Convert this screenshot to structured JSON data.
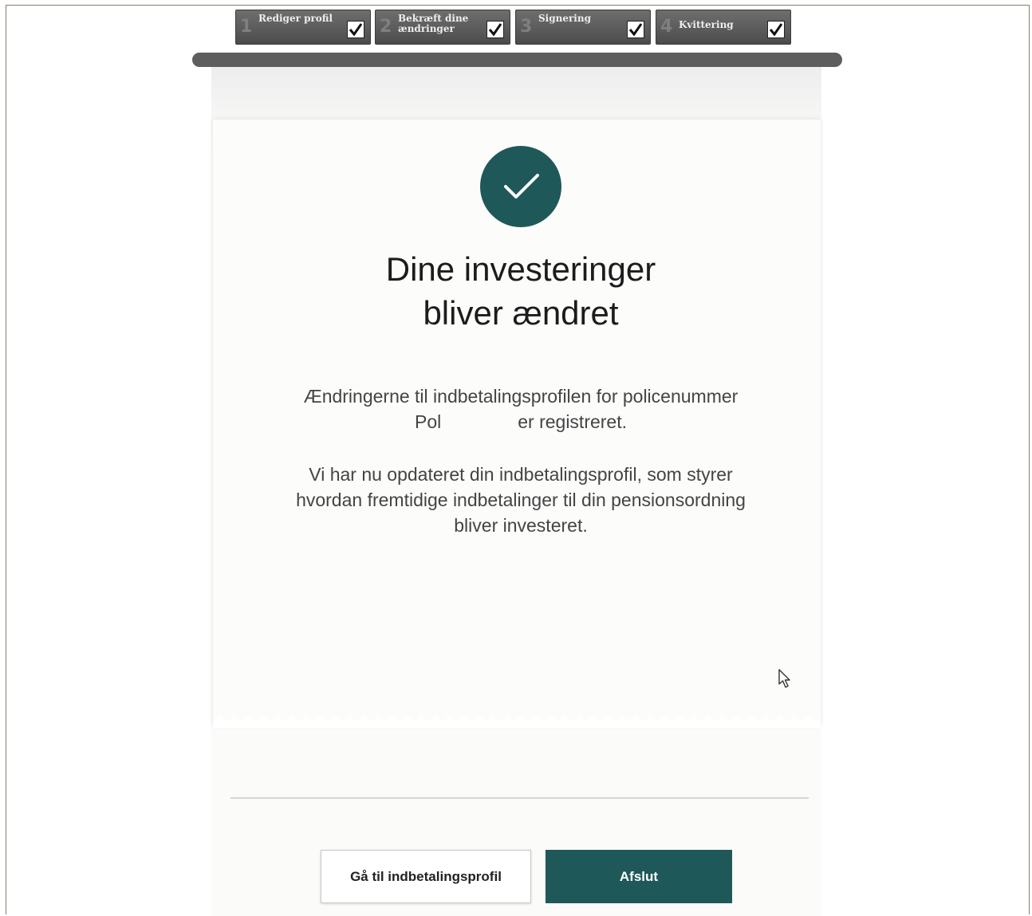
{
  "stepper": {
    "steps": [
      {
        "number": "1",
        "label": "Rediger profil",
        "checked": true
      },
      {
        "number": "2",
        "label": "Bekræft dine\nændringer",
        "checked": true
      },
      {
        "number": "3",
        "label": "Signering",
        "checked": true
      },
      {
        "number": "4",
        "label": "Kvittering",
        "checked": true
      }
    ]
  },
  "receipt": {
    "icon": "checkmark-icon",
    "headline_line1": "Dine investeringer",
    "headline_line2": "bliver ændret",
    "para1_line1": "Ændringerne til indbetalingsprofilen for policenummer",
    "para1_prefix": "Pol",
    "para1_suffix": "er registreret.",
    "para2_line1": "Vi har nu opdateret din indbetalingsprofil, som styrer",
    "para2_line2": "hvordan fremtidige indbetalinger til din pensionsordning",
    "para2_line3": "bliver investeret."
  },
  "actions": {
    "secondary_label": "Gå til indbetalingsprofil",
    "primary_label": "Afslut"
  },
  "colors": {
    "accent": "#1f5858",
    "stepper_bg": "#5a5a5a"
  }
}
